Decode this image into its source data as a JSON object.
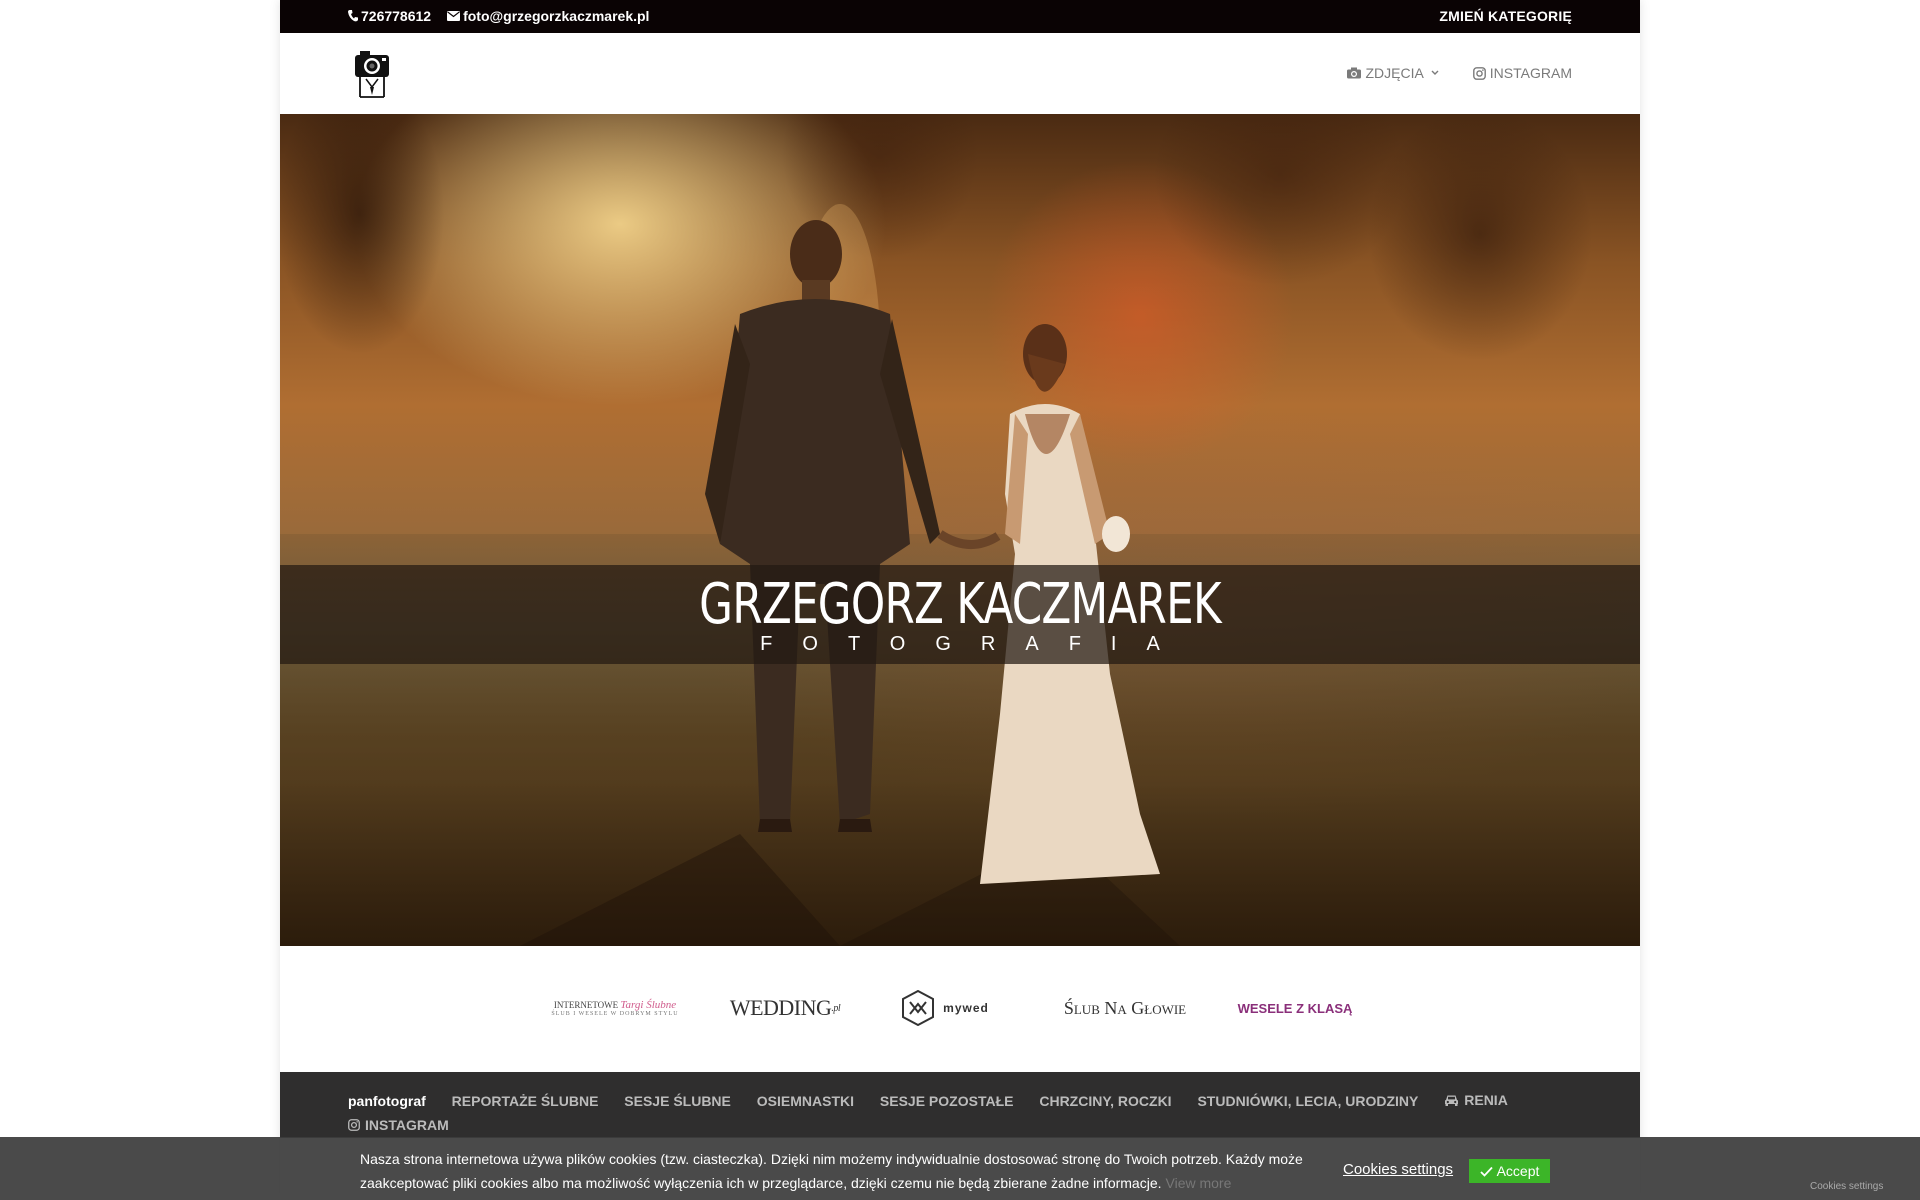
{
  "topbar": {
    "phone": "726778612",
    "email": "foto@grzegorzkaczmarek.pl",
    "change_category": "ZMIEŃ KATEGORIĘ"
  },
  "nav": {
    "items": [
      {
        "label": "ZDJĘCIA",
        "icon": "camera-icon"
      },
      {
        "label": "INSTAGRAM",
        "icon": "instagram-icon"
      }
    ]
  },
  "hero": {
    "title": "GRZEGORZ KACZMAREK",
    "subtitle": "FOTOGRAFIA"
  },
  "partners": {
    "p1_line1": "INTERNETOWE",
    "p1_script": "Targi Ślubne",
    "p1_line2": "ŚLUB I WESELE W DOBRYM STYLU",
    "p2": "WEDDING",
    "p2_suffix": ".pl",
    "p3": "mywed",
    "p4": "Ślub Na Głowie",
    "p5": "WESELE Z KLASĄ"
  },
  "footer_nav": {
    "brand": "panfotograf",
    "links": [
      "REPORTAŻE ŚLUBNE",
      "SESJE ŚLUBNE",
      "OSIEMNASTKI",
      "SESJE POZOSTAŁE",
      "CHRZCINY, ROCZKI",
      "STUDNIÓWKI, LECIA, URODZINY"
    ],
    "car_link": "RENIA",
    "instagram_link": "INSTAGRAM"
  },
  "cookie": {
    "text": "Nasza strona internetowa używa plików cookies (tzw. ciasteczka). Dzięki nim możemy indywidualnie dostosować stronę do Twoich potrzeb. Każdy może zaakceptować pliki cookies albo ma możliwość wyłączenia ich w przeglądarce, dzięki czemu nie będą zbierane żadne informacje.",
    "view_more": "View more",
    "settings": "Cookies settings",
    "accept": "Accept",
    "corner_settings": "Cookies settings"
  },
  "colors": {
    "topbar_bg": "#0a0304",
    "footer_bg": "#2f2e2e",
    "accept_green": "#3cb528"
  }
}
